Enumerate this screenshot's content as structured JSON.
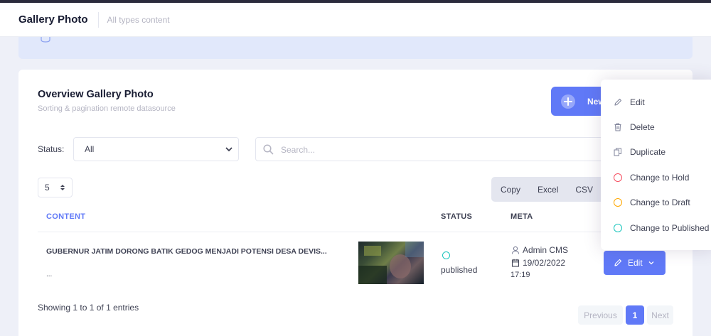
{
  "header": {
    "title": "Gallery Photo",
    "subtitle": "All types content"
  },
  "card": {
    "title": "Overview Gallery Photo",
    "subtitle": "Sorting & pagination remote datasource",
    "new_button_label": "New"
  },
  "filters": {
    "status_label": "Status:",
    "status_value": "All",
    "search_placeholder": "Search..."
  },
  "page_size": "5",
  "export": {
    "copy": "Copy",
    "excel": "Excel",
    "csv": "CSV"
  },
  "table": {
    "headers": {
      "content": "CONTENT",
      "status": "STATUS",
      "meta": "META"
    },
    "rows": [
      {
        "title": "GUBERNUR JATIM DORONG BATIK GEDOG MENJADI POTENSI DESA DEVIS...",
        "excerpt": "...",
        "status": "published",
        "author": "Admin CMS",
        "date": "19/02/2022",
        "time": "17:19",
        "action_label": "Edit"
      }
    ]
  },
  "footer": {
    "showing": "Showing 1 to 1 of 1 entries",
    "prev": "Previous",
    "current_page": "1",
    "next": "Next"
  },
  "dropdown": {
    "items": [
      {
        "label": "Edit",
        "icon": "pencil-icon"
      },
      {
        "label": "Delete",
        "icon": "trash-icon"
      },
      {
        "label": "Duplicate",
        "icon": "copy-icon"
      },
      {
        "label": "Change to Hold",
        "icon": "circle-icon",
        "color": "#f64e60"
      },
      {
        "label": "Change to Draft",
        "icon": "circle-icon",
        "color": "#ffa800"
      },
      {
        "label": "Change to Published",
        "icon": "circle-icon",
        "color": "#1bc5bd"
      }
    ]
  },
  "colors": {
    "primary": "#6079f7",
    "published": "#1bc5bd"
  }
}
